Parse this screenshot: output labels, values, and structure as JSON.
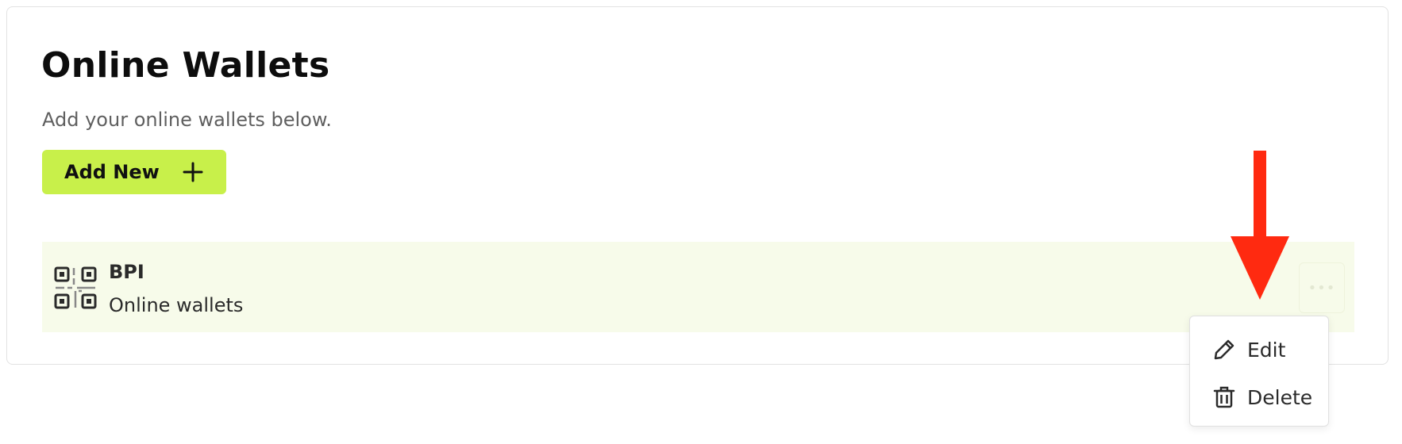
{
  "page": {
    "title": "Online Wallets",
    "subtitle": "Add your online wallets below."
  },
  "toolbar": {
    "add_label": "Add New",
    "add_icon": "plus-icon",
    "accent_color": "#c8f04a"
  },
  "wallets": [
    {
      "name": "BPI",
      "type": "Online wallets",
      "icon": "qr-code-icon",
      "more_icon": "more-options-icon"
    }
  ],
  "annotation": {
    "icon": "arrow-down-icon",
    "color": "#ff2a10"
  },
  "menu": {
    "items": [
      {
        "label": "Edit",
        "icon": "pencil-icon"
      },
      {
        "label": "Delete",
        "icon": "trash-icon"
      }
    ]
  }
}
